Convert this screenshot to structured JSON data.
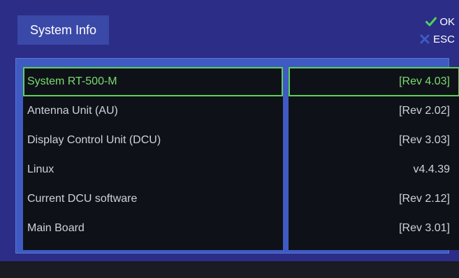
{
  "header": {
    "title": "System Info",
    "ok_label": "OK",
    "esc_label": "ESC"
  },
  "info_rows": [
    {
      "label": "System RT-500-M",
      "value": "[Rev 4.03]",
      "selected": true
    },
    {
      "label": "Antenna Unit (AU)",
      "value": "[Rev 2.02]",
      "selected": false
    },
    {
      "label": "Display Control Unit (DCU)",
      "value": "[Rev 3.03]",
      "selected": false
    },
    {
      "label": "Linux",
      "value": "v4.4.39",
      "selected": false
    },
    {
      "label": "Current DCU software",
      "value": "[Rev 2.12]",
      "selected": false
    },
    {
      "label": "Main Board",
      "value": "[Rev 3.01]",
      "selected": false
    }
  ],
  "colors": {
    "background": "#2b2d87",
    "panel": "#3f5bc3",
    "selected_text": "#78dd6e",
    "selected_border": "#5ed05a",
    "ok_check": "#4fd25a",
    "esc_x": "#3f5bc3"
  },
  "icons": {
    "ok": "check-icon",
    "esc": "x-icon"
  }
}
